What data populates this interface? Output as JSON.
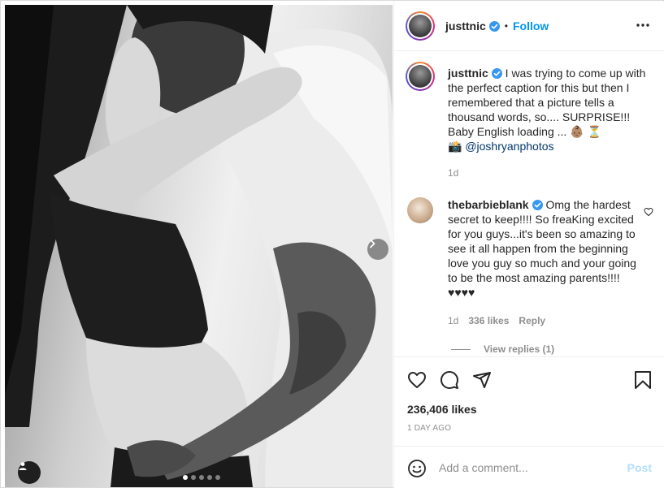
{
  "post": {
    "username": "justtnic",
    "follow_label": "Follow",
    "separator": "•",
    "caption": "I was trying to come up with the perfect caption for this but then I remembered that a picture tells a thousand words, so.... SURPRISE!!! Baby English loading ... 👶🏽 ⏳",
    "camera_emoji": "📸",
    "photo_credit": "@joshryanphotos",
    "caption_time": "1d",
    "likes": "236,406 likes",
    "date": "1 DAY AGO"
  },
  "comment": {
    "username": "thebarbieblank",
    "text": "Omg the hardest secret to keep!!!! So freaKing excited for you guys...it's been so amazing to see it all happen from the beginning love you guy so much and your going to be the most amazing parents!!!! ♥♥♥♥",
    "time": "1d",
    "likes": "336 likes",
    "reply_label": "Reply",
    "view_replies": "View replies (1)"
  },
  "composer": {
    "placeholder": "Add a comment...",
    "post_label": "Post"
  },
  "carousel": {
    "slide_count": 5,
    "active_index": 0
  },
  "colors": {
    "accent": "#0095f6",
    "mention": "#00376b",
    "muted": "#8e8e8e",
    "post_disabled": "#b2dffc"
  },
  "icons": [
    "chevron-right-icon",
    "user-icon",
    "verified-icon",
    "more-icon",
    "heart-icon",
    "comment-icon",
    "share-icon",
    "bookmark-icon",
    "emoji-icon"
  ]
}
